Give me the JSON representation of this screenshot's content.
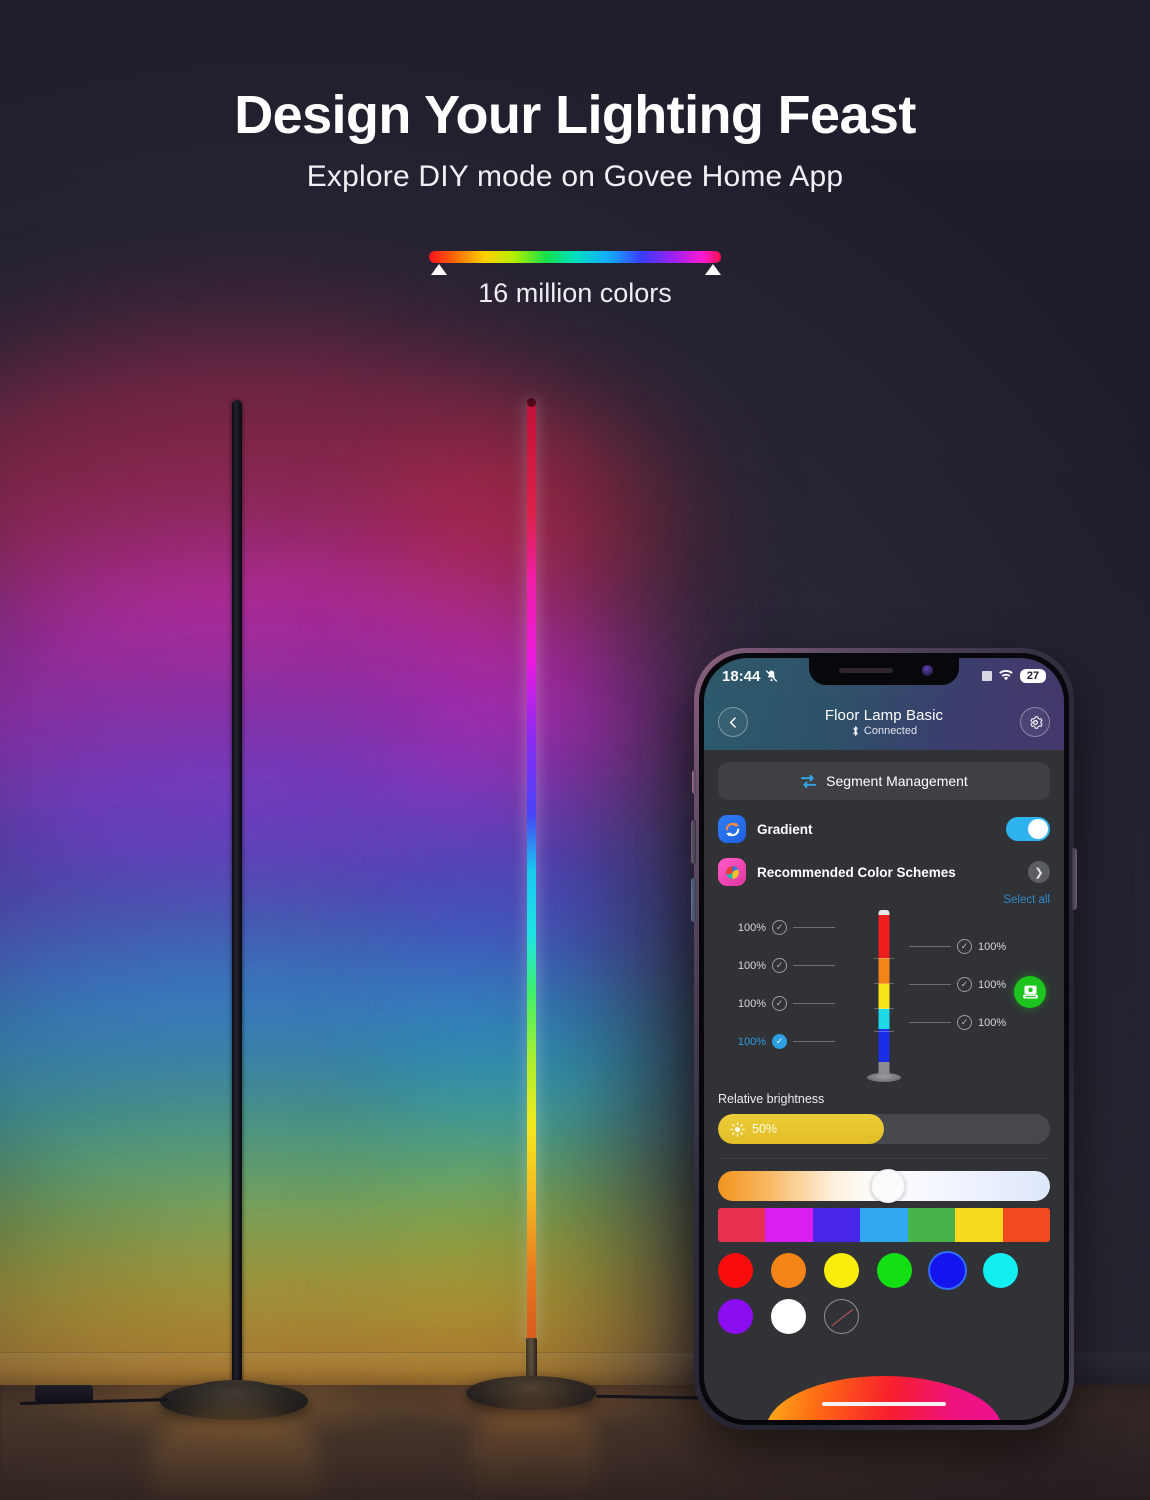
{
  "hero": {
    "headline": "Design Your Lighting Feast",
    "subhead": "Explore DIY mode on Govee Home App",
    "spectrum_caption": "16 million colors",
    "spectrum_left_marker": "left-marker",
    "spectrum_right_marker": "right-marker"
  },
  "phone": {
    "status_bar": {
      "time": "18:44",
      "silent_icon": "bell-mute-icon",
      "signal_icon": "cellular-signal-icon",
      "wifi_icon": "wifi-icon",
      "battery_level": "27"
    },
    "nav": {
      "back_icon": "chevron-left-icon",
      "title": "Floor Lamp Basic",
      "status": "Connected",
      "bluetooth_icon": "bluetooth-icon",
      "settings_icon": "gear-icon"
    },
    "segment_management": {
      "label": "Segment Management",
      "icon": "sliders-icon"
    },
    "rows": [
      {
        "label": "Gradient",
        "icon": "gradient-refresh-icon",
        "control": "toggle",
        "toggle_on": true
      },
      {
        "label": "Recommended Color Schemes",
        "icon": "color-wheel-icon",
        "control": "chevron",
        "chevron_icon": "chevron-right-icon"
      }
    ],
    "select_all": "Select all",
    "segments": {
      "left_column": [
        {
          "pct": "100%",
          "checked": false
        },
        {
          "pct": "100%",
          "checked": false
        },
        {
          "pct": "100%",
          "checked": false
        },
        {
          "pct": "100%",
          "checked": true
        }
      ],
      "right_column": [
        {
          "pct": "100%",
          "checked": false
        },
        {
          "pct": "100%",
          "checked": false
        },
        {
          "pct": "100%",
          "checked": false
        }
      ],
      "lamp_colors": [
        "#f01d1d",
        "#f58316",
        "#f5e519",
        "#1fd9e8",
        "#1a2ee8"
      ]
    },
    "camera_button_icon": "camera-scan-icon",
    "relative_brightness": {
      "label": "Relative brightness",
      "value": "50%",
      "percent": 50,
      "icon": "sun-icon",
      "fill_color": "#e6c52f"
    },
    "temperature_slider": {
      "knob_icon": "slider-handle",
      "knob_percent": 46
    },
    "scheme_swatches": [
      "#e8314f",
      "#d81ff0",
      "#4a25e8",
      "#2fa8f0",
      "#46b44a",
      "#f7d91e",
      "#f2491f"
    ],
    "color_swatches": [
      {
        "name": "red",
        "color": "#fb0d0d"
      },
      {
        "name": "orange",
        "color": "#f58418"
      },
      {
        "name": "yellow",
        "color": "#f8ed0c"
      },
      {
        "name": "green",
        "color": "#12e012"
      },
      {
        "name": "blue",
        "color": "#1414ef"
      },
      {
        "name": "cyan",
        "color": "#13eef0"
      },
      {
        "name": "purple",
        "color": "#8c0df2"
      },
      {
        "name": "white",
        "color": "#ffffff"
      },
      {
        "name": "none",
        "color": "none"
      }
    ],
    "home_indicator": "home-indicator"
  },
  "scene": {
    "lamp_left_name": "black-floor-lamp",
    "lamp_right_name": "rgb-floor-lamp",
    "background_color": "#2b2838"
  }
}
